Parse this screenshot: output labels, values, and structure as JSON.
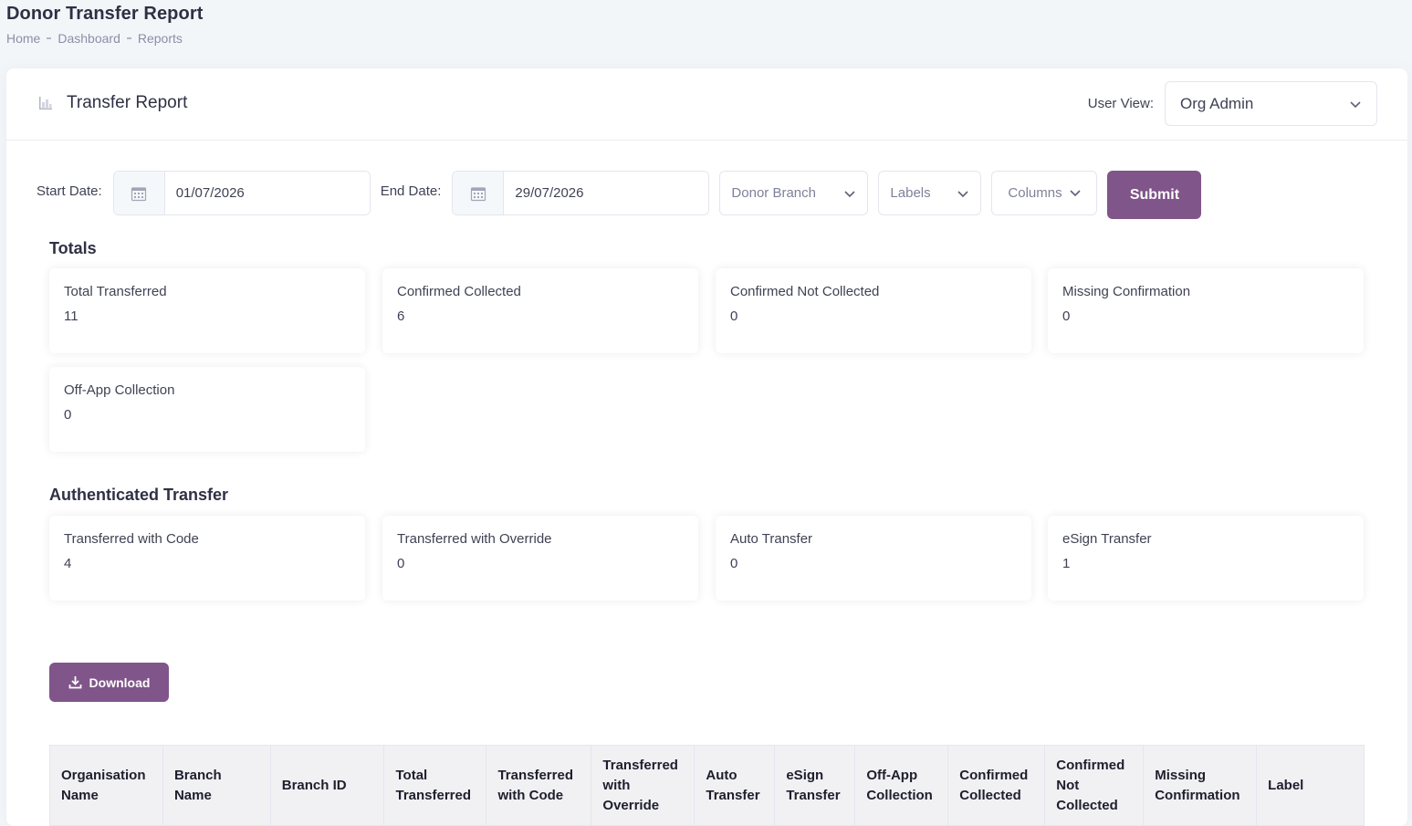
{
  "page": {
    "title": "Donor Transfer Report",
    "breadcrumb": [
      "Home",
      "Dashboard",
      "Reports"
    ]
  },
  "card": {
    "title": "Transfer Report",
    "user_view_label": "User View:",
    "user_view_value": "Org Admin"
  },
  "filters": {
    "start_label": "Start Date:",
    "start_value": "01/07/2026",
    "end_label": "End Date:",
    "end_value": "29/07/2026",
    "donor_branch": "Donor Branch",
    "labels": "Labels",
    "columns": "Columns",
    "submit": "Submit"
  },
  "totals": {
    "title": "Totals",
    "items": [
      {
        "label": "Total Transferred",
        "value": "11"
      },
      {
        "label": "Confirmed Collected",
        "value": "6"
      },
      {
        "label": "Confirmed Not Collected",
        "value": "0"
      },
      {
        "label": "Missing Confirmation",
        "value": "0"
      },
      {
        "label": "Off-App Collection",
        "value": "0"
      }
    ]
  },
  "authenticated": {
    "title": "Authenticated Transfer",
    "items": [
      {
        "label": "Transferred with Code",
        "value": "4"
      },
      {
        "label": "Transferred with Override",
        "value": "0"
      },
      {
        "label": "Auto Transfer",
        "value": "0"
      },
      {
        "label": "eSign Transfer",
        "value": "1"
      }
    ]
  },
  "download_label": "Download",
  "table": {
    "headers": [
      [
        "Organisation",
        "Name"
      ],
      [
        "Branch",
        "Name"
      ],
      [
        "Branch ID"
      ],
      [
        "Total",
        "Transferred"
      ],
      [
        "Transferred",
        "with Code"
      ],
      [
        "Transferred",
        "with",
        "Override"
      ],
      [
        "Auto",
        "Transfer"
      ],
      [
        "eSign",
        "Transfer"
      ],
      [
        "Off-App",
        "Collection"
      ],
      [
        "Confirmed",
        "Collected"
      ],
      [
        "Confirmed",
        "Not",
        "Collected"
      ],
      [
        "Missing",
        "Confirmation"
      ],
      [
        "Label"
      ]
    ]
  },
  "colors": {
    "primary": "#80558a",
    "background": "#f3f6f9"
  }
}
